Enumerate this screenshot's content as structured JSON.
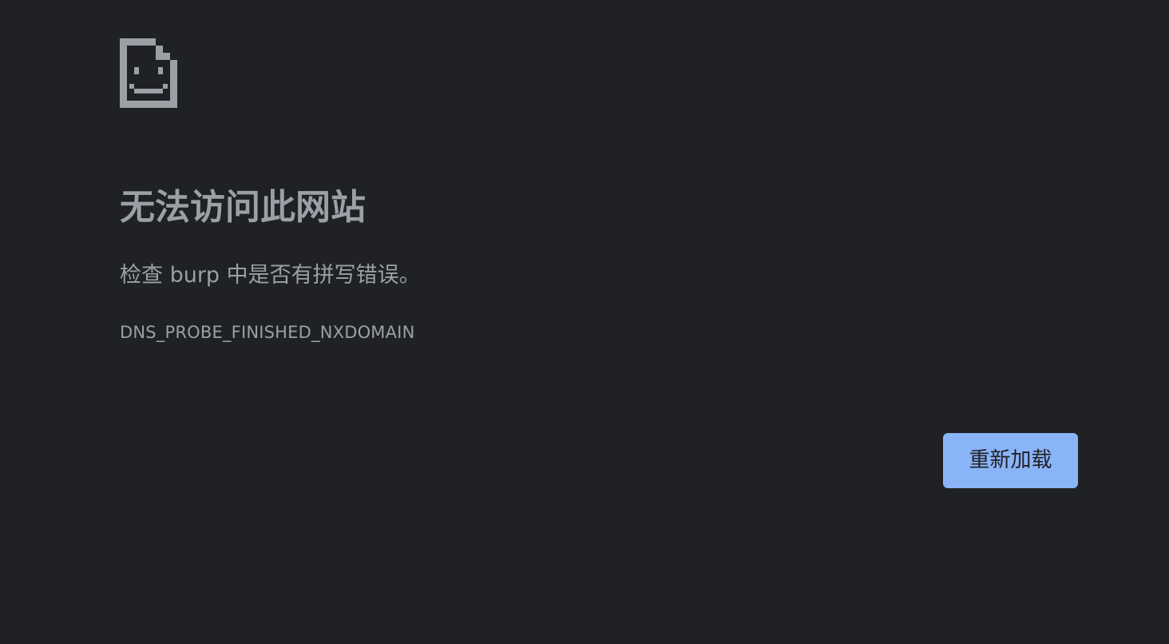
{
  "error": {
    "icon": "sad-document-icon",
    "title": "无法访问此网站",
    "suggestion": "检查 burp 中是否有拼写错误。",
    "code": "DNS_PROBE_FINISHED_NXDOMAIN"
  },
  "actions": {
    "reload_label": "重新加载"
  },
  "colors": {
    "background": "#202124",
    "text": "#9aa0a6",
    "icon": "#9aa0a6",
    "button_background": "#8ab4f8",
    "button_text": "#202124"
  }
}
